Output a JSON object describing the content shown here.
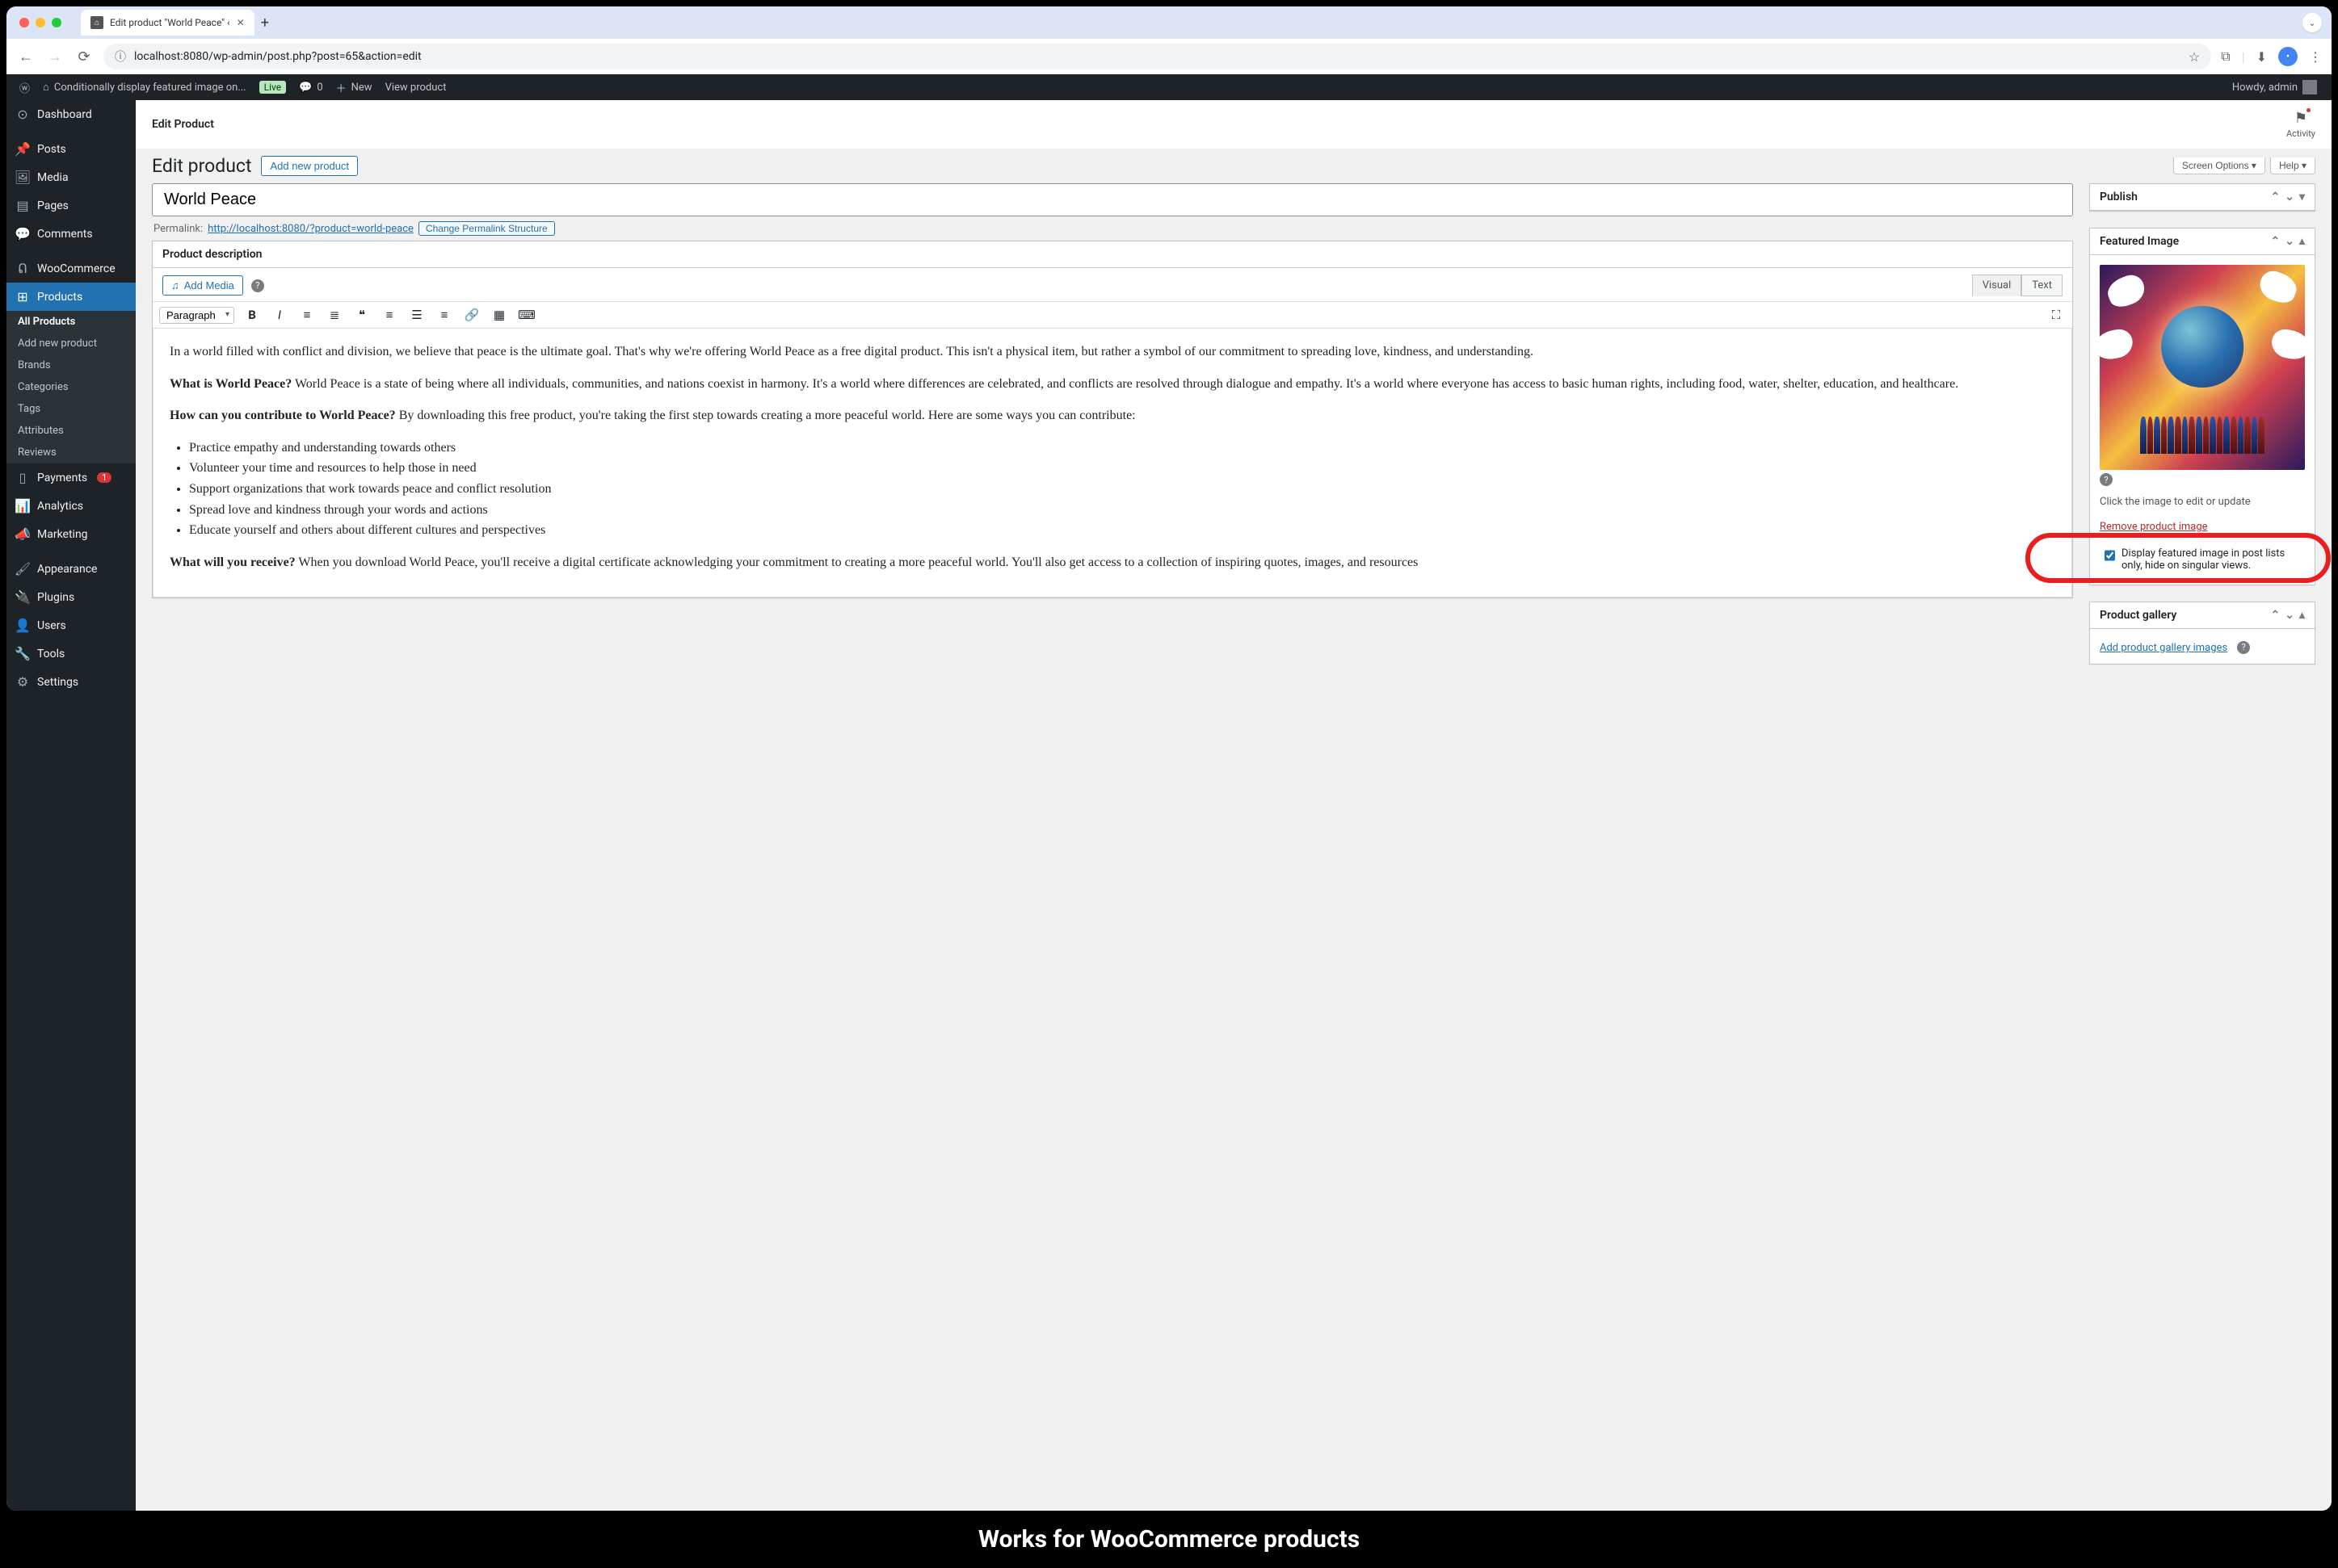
{
  "browser": {
    "tab_title": "Edit product \"World Peace\" ‹",
    "url": "localhost:8080/wp-admin/post.php?post=65&action=edit"
  },
  "admin_bar": {
    "site_name": "Conditionally display featured image on...",
    "live": "Live",
    "comments": "0",
    "new": "New",
    "view": "View product",
    "howdy": "Howdy, admin"
  },
  "sidebar": {
    "dashboard": "Dashboard",
    "posts": "Posts",
    "media": "Media",
    "pages": "Pages",
    "comments": "Comments",
    "woocommerce": "WooCommerce",
    "products": "Products",
    "products_sub": {
      "all": "All Products",
      "add": "Add new product",
      "brands": "Brands",
      "categories": "Categories",
      "tags": "Tags",
      "attributes": "Attributes",
      "reviews": "Reviews"
    },
    "payments": "Payments",
    "payments_badge": "1",
    "analytics": "Analytics",
    "marketing": "Marketing",
    "appearance": "Appearance",
    "plugins": "Plugins",
    "users": "Users",
    "tools": "Tools",
    "settings": "Settings"
  },
  "header": {
    "edit_product_label": "Edit Product",
    "activity": "Activity"
  },
  "page": {
    "heading": "Edit product",
    "add_new": "Add new product",
    "screen_options": "Screen Options",
    "help": "Help",
    "title_value": "World Peace",
    "permalink_label": "Permalink:",
    "permalink_url": "http://localhost:8080/?product=world-peace",
    "permalink_btn": "Change Permalink Structure"
  },
  "editor": {
    "box_title": "Product description",
    "add_media": "Add Media",
    "tab_visual": "Visual",
    "tab_text": "Text",
    "paragraph": "Paragraph",
    "content": {
      "p1": "In a world filled with conflict and division, we believe that peace is the ultimate goal. That's why we're offering World Peace as a free digital product. This isn't a physical item, but rather a symbol of our commitment to spreading love, kindness, and understanding.",
      "h2a": "What is World Peace?",
      "p2": " World Peace is a state of being where all individuals, communities, and nations coexist in harmony. It's a world where differences are celebrated, and conflicts are resolved through dialogue and empathy. It's a world where everyone has access to basic human rights, including food, water, shelter, education, and healthcare.",
      "h2b": "How can you contribute to World Peace?",
      "p3": " By downloading this free product, you're taking the first step towards creating a more peaceful world. Here are some ways you can contribute:",
      "li1": "Practice empathy and understanding towards others",
      "li2": "Volunteer your time and resources to help those in need",
      "li3": "Support organizations that work towards peace and conflict resolution",
      "li4": "Spread love and kindness through your words and actions",
      "li5": "Educate yourself and others about different cultures and perspectives",
      "h2c": "What will you receive?",
      "p4": " When you download World Peace, you'll receive a digital certificate acknowledging your commitment to creating a more peaceful world. You'll also get access to a collection of inspiring quotes, images, and resources"
    }
  },
  "side": {
    "publish": "Publish",
    "featured_image": "Featured Image",
    "click_to_edit": "Click the image to edit or update",
    "remove_image": "Remove product image",
    "checkbox_label": "Display featured image in post lists only, hide on singular views.",
    "product_gallery": "Product gallery",
    "add_gallery": "Add product gallery images"
  },
  "caption": "Works for WooCommerce products"
}
